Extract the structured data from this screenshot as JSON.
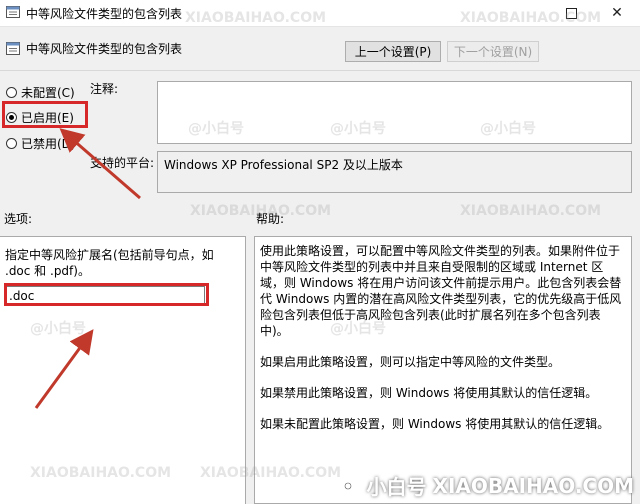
{
  "window": {
    "title": "中等风险文件类型的包含列表",
    "header": "中等风险文件类型的包含列表"
  },
  "nav": {
    "prev_label": "上一个设置(P)",
    "next_label": "下一个设置(N)"
  },
  "state": {
    "options": [
      {
        "label": "未配置(C)",
        "checked": false
      },
      {
        "label": "已启用(E)",
        "checked": true
      },
      {
        "label": "已禁用(D)",
        "checked": false
      }
    ]
  },
  "comment": {
    "label": "注释:",
    "value": ""
  },
  "platform": {
    "label": "支持的平台:",
    "value": "Windows XP Professional SP2 及以上版本"
  },
  "options_section": {
    "label": "选项:",
    "description": "指定中等风险扩展名(包括前导句点，如 .doc 和 .pdf)。",
    "input_value": ".doc"
  },
  "help_section": {
    "label": "帮助:",
    "paragraphs": [
      "使用此策略设置，可以配置中等风险文件类型的列表。如果附件位于中等风险文件类型的列表中并且来自受限制的区域或 Internet 区域，则 Windows 将在用户访问该文件前提示用户。此包含列表会替代 Windows 内置的潜在高风险文件类型列表，它的优先级高于低风险包含列表但低于高风险包含列表(此时扩展名列在多个包含列表中)。",
      "如果启用此策略设置，则可以指定中等风险的文件类型。",
      "如果禁用此策略设置，则 Windows 将使用其默认的信任逻辑。",
      "如果未配置此策略设置，则 Windows 将使用其默认的信任逻辑。"
    ]
  },
  "watermark": {
    "handle": "@小白号",
    "domain": "XIAOBAIHAO.COM"
  },
  "brand": {
    "name": "小白号",
    "domain": "XIAOBAIHAO.COM"
  },
  "colors": {
    "highlight_red": "#d62828"
  }
}
